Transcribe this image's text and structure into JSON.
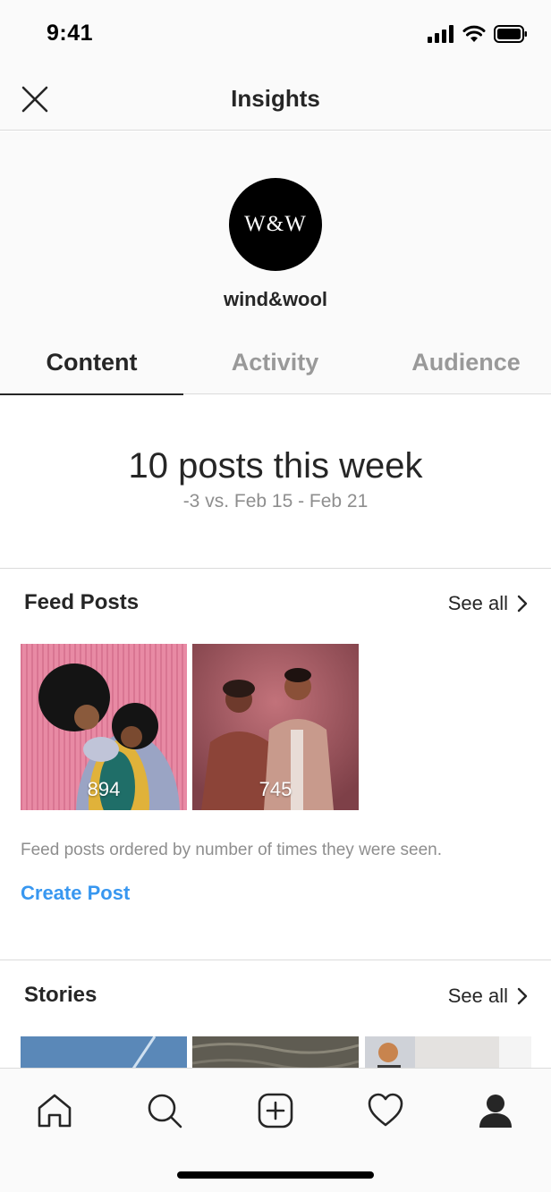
{
  "status_bar": {
    "time": "9:41"
  },
  "header": {
    "title": "Insights"
  },
  "profile": {
    "avatar_text": "W&W",
    "username": "wind&wool"
  },
  "tabs": [
    {
      "label": "Content",
      "active": true
    },
    {
      "label": "Activity",
      "active": false
    },
    {
      "label": "Audience",
      "active": false
    }
  ],
  "summary": {
    "headline": "10 posts this week",
    "comparison": "-3 vs. Feb 15 - Feb 21"
  },
  "feed_posts": {
    "title": "Feed Posts",
    "see_all_label": "See all",
    "posts": [
      {
        "count": "894"
      },
      {
        "count": "745"
      }
    ],
    "note": "Feed posts ordered by number of times they were seen.",
    "create_label": "Create Post"
  },
  "stories": {
    "title": "Stories",
    "see_all_label": "See all"
  },
  "colors": {
    "accent": "#3897f0",
    "text": "#262626",
    "muted": "#8e8e8e",
    "divider": "#dbdbdb"
  },
  "bottom_nav": [
    "home-icon",
    "search-icon",
    "add-post-icon",
    "heart-icon",
    "profile-icon"
  ]
}
